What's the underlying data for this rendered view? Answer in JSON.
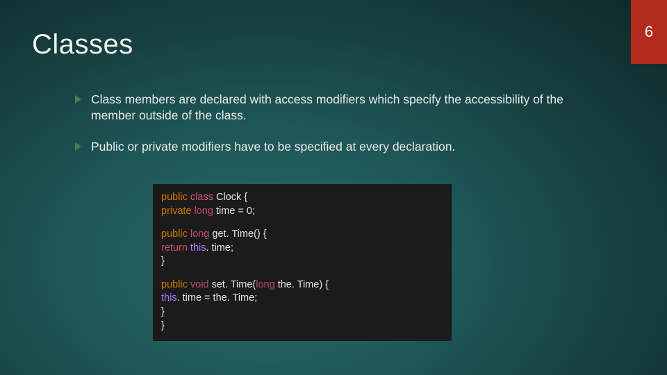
{
  "page_number": "6",
  "title": "Classes",
  "bullets": [
    "Class members are declared with access modifiers which specify the accessibility of the member outside of the class.",
    "Public or private modifiers have to be specified at every declaration."
  ],
  "code": {
    "l1": {
      "mod": "public ",
      "cls": "class ",
      "name": "Clock ",
      "brace": "{"
    },
    "l2": {
      "mod": "private ",
      "type": "long ",
      "rest": "time = 0;"
    },
    "l3": {
      "mod": "public ",
      "type": "long ",
      "fn": "get. Time",
      "rest": "() {"
    },
    "l4": {
      "ret": "return ",
      "this": "this",
      "rest": ". time;"
    },
    "l5": {
      "brace": "}"
    },
    "l6": {
      "mod": "public ",
      "type": "void ",
      "fn": "set. Time",
      "lp": "(",
      "argtype": "long ",
      "arg": "the. Time",
      "rp": ") {"
    },
    "l7": {
      "this": "this",
      "rest": ". time = the. Time;"
    },
    "l8": {
      "brace": "}"
    },
    "l9": {
      "brace": "}"
    }
  }
}
